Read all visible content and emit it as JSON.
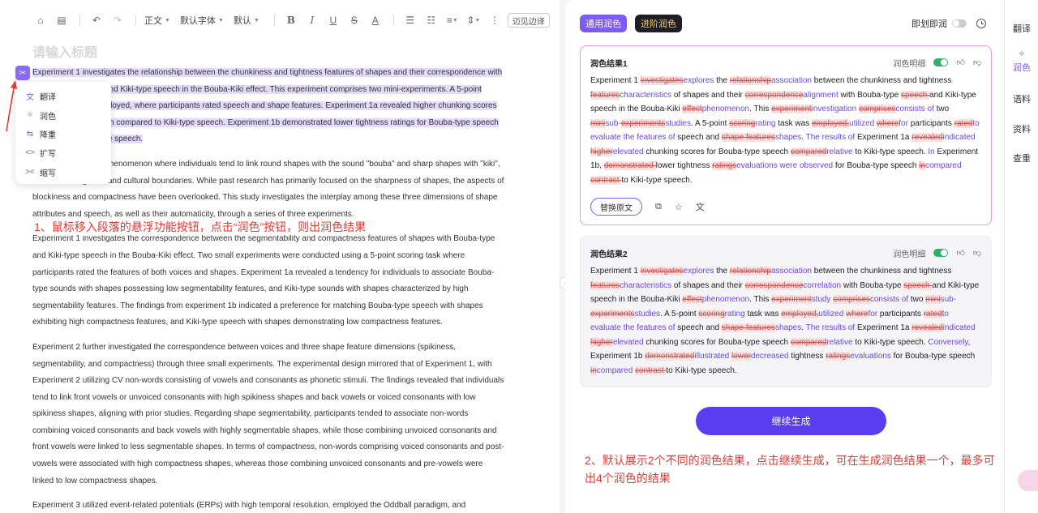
{
  "toolbar": {
    "style_label": "正文",
    "font_label": "默认字体",
    "size_label": "默认",
    "margin_label": "迈见边译"
  },
  "editor": {
    "title_placeholder": "请输入标题",
    "selected_paragraph": "Experiment 1 investigates the relationship between the chunkiness and tightness features of shapes and their correspondence with Bouba-type speech and Kiki-type speech in the Bouba-Kiki effect. This experiment comprises two mini-experiments. A 5-point scoring task was employed, where participants rated speech and shape features. Experiment 1a revealed higher chunking scores for Bouba-type speech compared to Kiki-type speech. Experiment 1b demonstrated lower tightness ratings for Bouba-type speech in contrast to Kiki-type speech.",
    "paragraphs": [
      "Bouba-Kiki effect, a phenomenon where individuals tend to link round shapes with the sound \"bouba\" and sharp shapes with \"kiki\", transcends linguistic and cultural boundaries. While past research has primarily focused on the sharpness of shapes, the aspects of blockiness and compactness have been overlooked. This study investigates the interplay among these three dimensions of shape attributes and speech, as well as their automaticity, through a series of three experiments.",
      "Experiment 1 investigates the correspondence between the segmentability and compactness features of shapes with Bouba-type and Kiki-type speech in the Bouba-Kiki effect. Two small experiments were conducted using a 5-point scoring task where participants rated the features of both voices and shapes. Experiment 1a revealed a tendency for individuals to associate Bouba-type sounds with shapes possessing low segmentability features, and Kiki-type sounds with shapes characterized by high segmentability features. The findings from experiment 1b indicated a preference for matching Bouba-type speech with shapes exhibiting high compactness features, and Kiki-type speech with shapes demonstrating low compactness features.",
      "Experiment 2 further investigated the correspondence between voices and three shape feature dimensions (spikiness, segmentability, and compactness) through three small experiments. The experimental design mirrored that of Experiment 1, with Experiment 2 utilizing CV non-words consisting of vowels and consonants as phonetic stimuli. The findings revealed that individuals tend to link front vowels or unvoiced consonants with high spikiness shapes and back vowels or voiced consonants with low spikiness shapes, aligning with prior studies. Regarding shape segmentability, participants tended to associate non-words combining voiced consonants and back vowels with highly segmentable shapes, while those combining unvoiced consonants and front vowels were linked to less segmentable shapes. In terms of compactness, non-words comprising voiced consonants and post-vowels were associated with high compactness shapes, whereas those combining unvoiced consonants and pre-vowels were linked to low compactness shapes.",
      "Experiment 3 utilized event-related potentials (ERPs) with high temporal resolution, employed the Oddball paradigm, and"
    ],
    "annotation": "1、鼠标移入段落的悬浮功能按钮，点击“润色”按钮，则出润色结果"
  },
  "popup": {
    "items": [
      "翻译",
      "润色",
      "降重",
      "扩写",
      "缩写"
    ]
  },
  "panel": {
    "tab_general": "通用润色",
    "tab_advanced": "进阶润色",
    "instant_label": "即划即润",
    "card_toggle_label": "润色明细",
    "result1_title": "润色结果1",
    "result2_title": "润色结果2",
    "replace_button": "替换原文",
    "continue_button": "继续生成",
    "annotation": "2、默认展示2个不同的润色结果，点击继续生成，可在生成润色结果一个，最多可出4个润色的结果",
    "result1_tokens": [
      [
        "t",
        "Experiment 1 "
      ],
      [
        "d",
        "investigates"
      ],
      [
        "i",
        "explores"
      ],
      [
        "t",
        " the "
      ],
      [
        "d",
        "relationship"
      ],
      [
        "i",
        "association"
      ],
      [
        "t",
        " between the chunkiness and tightness "
      ],
      [
        "d",
        "features"
      ],
      [
        "i",
        "characteristics"
      ],
      [
        "t",
        " of shapes and their "
      ],
      [
        "d",
        "correspondence"
      ],
      [
        "i",
        "alignment"
      ],
      [
        "t",
        " with Bouba-type "
      ],
      [
        "d",
        "speech "
      ],
      [
        "t",
        "and Kiki-type speech in the Bouba-Kiki "
      ],
      [
        "d",
        "effect"
      ],
      [
        "i",
        "phenomenon"
      ],
      [
        "t",
        ". This "
      ],
      [
        "d",
        "experiment"
      ],
      [
        "i",
        "investigation"
      ],
      [
        "t",
        " "
      ],
      [
        "d",
        "comprises"
      ],
      [
        "i",
        "consists of"
      ],
      [
        "t",
        " two "
      ],
      [
        "d",
        "mini"
      ],
      [
        "i",
        "sub-"
      ],
      [
        "d",
        "experiments"
      ],
      [
        "i",
        "studies"
      ],
      [
        "t",
        ". A 5-point "
      ],
      [
        "d",
        "scoring"
      ],
      [
        "i",
        "rating"
      ],
      [
        "t",
        " task was "
      ],
      [
        "d",
        "employed,"
      ],
      [
        "i",
        "utilized"
      ],
      [
        "t",
        " "
      ],
      [
        "d",
        "where"
      ],
      [
        "i",
        "for"
      ],
      [
        "t",
        " participants "
      ],
      [
        "d",
        "rated"
      ],
      [
        "i",
        "to evaluate the features of"
      ],
      [
        "t",
        " speech and "
      ],
      [
        "d",
        "shape features"
      ],
      [
        "i",
        "shapes"
      ],
      [
        "t",
        ". "
      ],
      [
        "i",
        "The results of"
      ],
      [
        "t",
        " Experiment 1a "
      ],
      [
        "d",
        "revealed"
      ],
      [
        "i",
        "indicated"
      ],
      [
        "t",
        " "
      ],
      [
        "d",
        "higher"
      ],
      [
        "i",
        "elevated"
      ],
      [
        "t",
        " chunking scores for Bouba-type speech "
      ],
      [
        "d",
        "compared"
      ],
      [
        "i",
        "relative"
      ],
      [
        "t",
        " to Kiki-type speech. "
      ],
      [
        "i",
        "In"
      ],
      [
        "t",
        " Experiment 1b, "
      ],
      [
        "d",
        "demonstrated "
      ],
      [
        "t",
        "lower tightness "
      ],
      [
        "d",
        "ratings"
      ],
      [
        "i",
        "evaluations were observed"
      ],
      [
        "t",
        " for Bouba-type speech "
      ],
      [
        "d",
        "in"
      ],
      [
        "i",
        "compared"
      ],
      [
        "t",
        " "
      ],
      [
        "d",
        "contrast "
      ],
      [
        "t",
        "to Kiki-type speech."
      ]
    ],
    "result2_tokens": [
      [
        "t",
        "Experiment 1 "
      ],
      [
        "d",
        "investigates"
      ],
      [
        "i",
        "explores"
      ],
      [
        "t",
        " the "
      ],
      [
        "d",
        "relationship"
      ],
      [
        "i",
        "association"
      ],
      [
        "t",
        " between the chunkiness and tightness "
      ],
      [
        "d",
        "features"
      ],
      [
        "i",
        "characteristics"
      ],
      [
        "t",
        " of shapes and their "
      ],
      [
        "d",
        "correspondence"
      ],
      [
        "i",
        "correlation"
      ],
      [
        "t",
        " with Bouba-type "
      ],
      [
        "d",
        "speech "
      ],
      [
        "t",
        "and Kiki-type speech in the Bouba-Kiki "
      ],
      [
        "d",
        "effect"
      ],
      [
        "i",
        "phenomenon"
      ],
      [
        "t",
        ". This "
      ],
      [
        "d",
        "experiment"
      ],
      [
        "i",
        "study"
      ],
      [
        "t",
        " "
      ],
      [
        "d",
        "comprises"
      ],
      [
        "i",
        "consists of"
      ],
      [
        "t",
        " two "
      ],
      [
        "d",
        "mini"
      ],
      [
        "i",
        "sub-"
      ],
      [
        "d",
        "experiments"
      ],
      [
        "i",
        "studies"
      ],
      [
        "t",
        ". A 5-point "
      ],
      [
        "d",
        "scoring"
      ],
      [
        "i",
        "rating"
      ],
      [
        "t",
        " task was "
      ],
      [
        "d",
        "employed,"
      ],
      [
        "i",
        "utilized"
      ],
      [
        "t",
        " "
      ],
      [
        "d",
        "where"
      ],
      [
        "i",
        "for"
      ],
      [
        "t",
        " participants "
      ],
      [
        "d",
        "rated"
      ],
      [
        "i",
        "to evaluate the features of"
      ],
      [
        "t",
        " speech and "
      ],
      [
        "d",
        "shape features"
      ],
      [
        "i",
        "shapes"
      ],
      [
        "t",
        ". "
      ],
      [
        "i",
        "The results of"
      ],
      [
        "t",
        " Experiment 1a "
      ],
      [
        "d",
        "revealed"
      ],
      [
        "i",
        "indicated"
      ],
      [
        "t",
        " "
      ],
      [
        "d",
        "higher"
      ],
      [
        "i",
        "elevated"
      ],
      [
        "t",
        " chunking scores for Bouba-type speech "
      ],
      [
        "d",
        "compared"
      ],
      [
        "i",
        "relative"
      ],
      [
        "t",
        " to Kiki-type speech. "
      ],
      [
        "i",
        "Conversely"
      ],
      [
        "t",
        ", Experiment 1b "
      ],
      [
        "d",
        "demonstrated"
      ],
      [
        "i",
        "illustrated"
      ],
      [
        "t",
        " "
      ],
      [
        "d",
        "lower"
      ],
      [
        "i",
        "decreased"
      ],
      [
        "t",
        " tightness "
      ],
      [
        "d",
        "ratings"
      ],
      [
        "i",
        "evaluations"
      ],
      [
        "t",
        " for Bouba-type speech "
      ],
      [
        "d",
        "in"
      ],
      [
        "i",
        "compared"
      ],
      [
        "t",
        " "
      ],
      [
        "d",
        "contrast "
      ],
      [
        "t",
        "to Kiki-type speech."
      ]
    ]
  },
  "sidebar": {
    "items": [
      "翻译",
      "润色",
      "语料",
      "资料",
      "查重"
    ]
  },
  "colors": {
    "accent": "#7c5cf0",
    "highlight": "#e2dbfb",
    "annotation_red": "#e53935",
    "deleted": "#c55",
    "inserted": "#6b47e0"
  }
}
